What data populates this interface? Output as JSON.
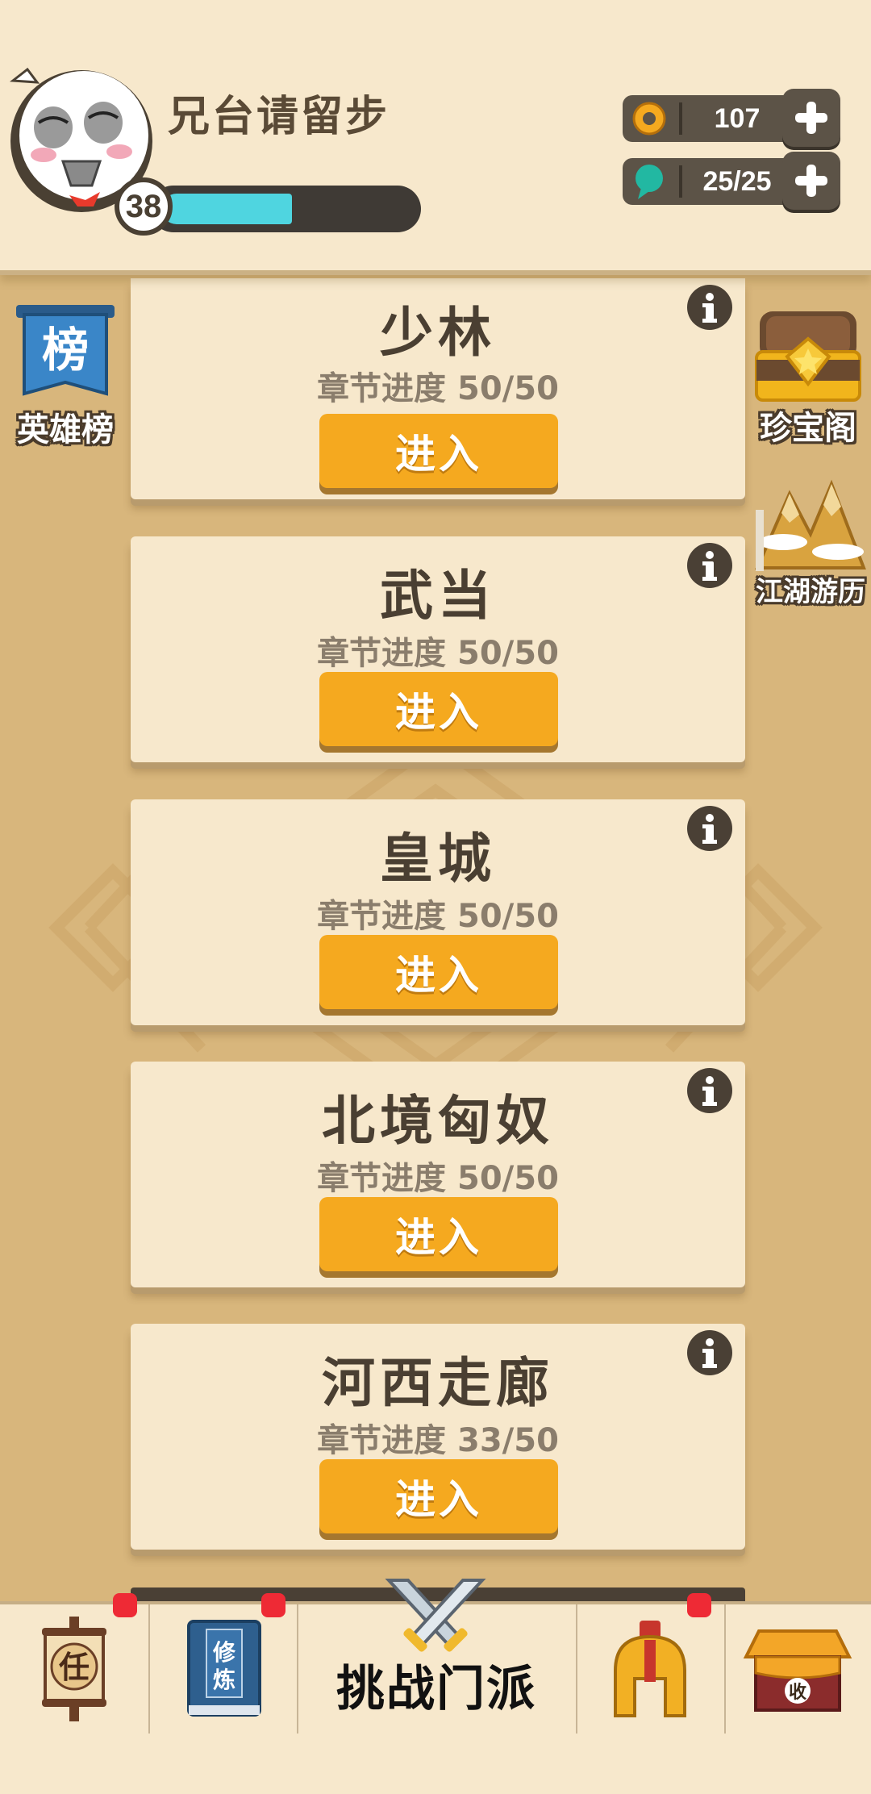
{
  "player": {
    "name": "兄台请留步",
    "level": "38",
    "xp_fraction": 0.52
  },
  "currency": {
    "coins": "107",
    "energy": "25/25"
  },
  "side_left": {
    "leaderboard_label": "英雄榜",
    "leaderboard_icon_char": "榜"
  },
  "side_right": {
    "treasure_label": "珍宝阁",
    "travel_label": "江湖游历"
  },
  "sects": [
    {
      "name": "少林",
      "progress": "章节进度 50/50",
      "button": "进入"
    },
    {
      "name": "武当",
      "progress": "章节进度 50/50",
      "button": "进入"
    },
    {
      "name": "皇城",
      "progress": "章节进度 50/50",
      "button": "进入"
    },
    {
      "name": "北境匈奴",
      "progress": "章节进度 50/50",
      "button": "进入"
    },
    {
      "name": "河西走廊",
      "progress": "章节进度 33/50",
      "button": "进入"
    }
  ],
  "bottom_nav": {
    "task_char": "任",
    "cultivate_text": "修炼",
    "center_label": "挑战门派",
    "shop_char": "收"
  },
  "colors": {
    "accent_button": "#f5a91f",
    "xp_fill": "#4fd5e0",
    "badge_red": "#ee2a35",
    "background": "#d8b67c",
    "card": "#f7e8cc"
  }
}
